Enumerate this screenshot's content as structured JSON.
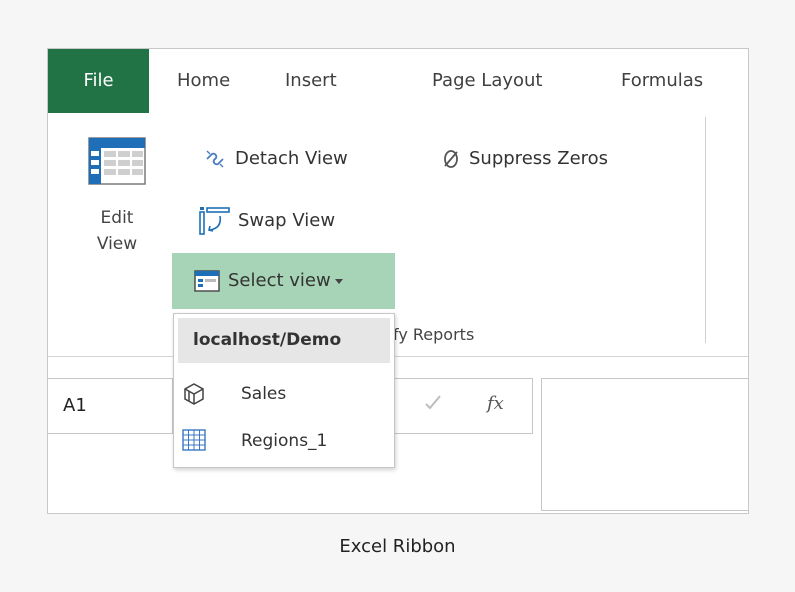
{
  "tabs": [
    {
      "label": "File"
    },
    {
      "label": "Home"
    },
    {
      "label": "Insert"
    },
    {
      "label": "Page Layout"
    },
    {
      "label": "Formulas"
    }
  ],
  "ribbon": {
    "edit_view": {
      "line1": "Edit",
      "line2": "View",
      "icon": "table-view-icon"
    },
    "detach_view": {
      "label": "Detach View",
      "icon": "chain-broken-icon"
    },
    "suppress_zeros": {
      "label": "Suppress Zeros",
      "icon": "zero-slash-icon"
    },
    "swap_view": {
      "label": "Swap View",
      "icon": "swap-icon"
    },
    "select_view": {
      "label": "Select view",
      "icon": "view-window-icon"
    },
    "group_label": "fy Reports"
  },
  "formula_bar": {
    "name_box": "A1",
    "fx_label": "fx"
  },
  "dropdown": {
    "header": "localhost/Demo",
    "items": [
      {
        "label": "Sales",
        "icon": "cube-icon"
      },
      {
        "label": "Regions_1",
        "icon": "grid-icon"
      }
    ]
  },
  "caption": "Excel Ribbon",
  "colors": {
    "file_tab": "#217346",
    "select_highlight": "#a7d3b6",
    "header_bg": "#e6e6e6"
  }
}
